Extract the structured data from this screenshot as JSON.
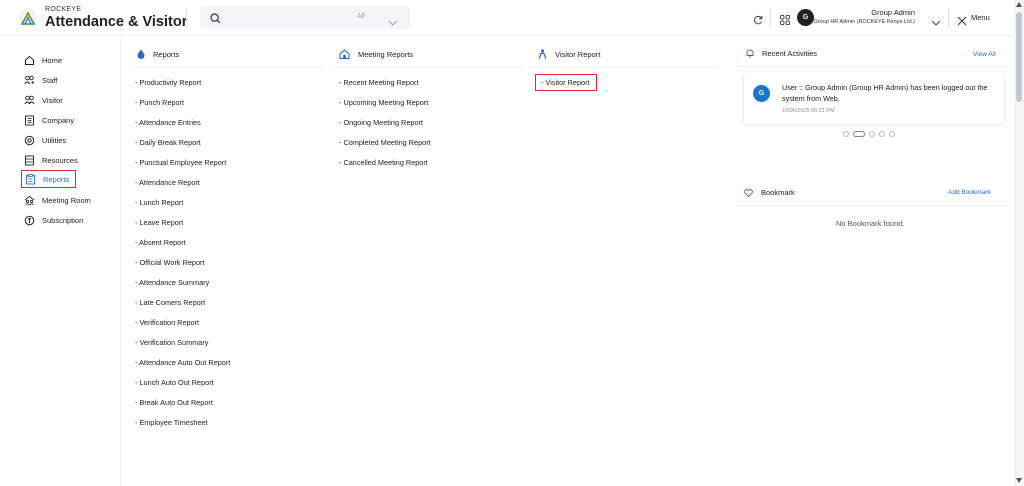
{
  "header": {
    "brand_small": "ROCKEYE",
    "brand_big": "Attendance & Visitor",
    "search_scope": "All",
    "user_name": "Group Admin",
    "user_role": "Group HR Admin (ROCKEYE Kenya Ltd.)",
    "avatar_letter": "G",
    "menu_label": "Menu"
  },
  "sidebar": {
    "items": [
      {
        "label": "Home",
        "icon": "home-icon"
      },
      {
        "label": "Staff",
        "icon": "staff-icon"
      },
      {
        "label": "Visitor",
        "icon": "visitor-icon"
      },
      {
        "label": "Company",
        "icon": "company-icon"
      },
      {
        "label": "Utilities",
        "icon": "utilities-icon"
      },
      {
        "label": "Resources",
        "icon": "resources-icon"
      },
      {
        "label": "Reports",
        "icon": "reports-icon"
      },
      {
        "label": "Meeting Room",
        "icon": "meeting-room-icon"
      },
      {
        "label": "Subscription",
        "icon": "subscription-icon"
      }
    ],
    "active": "Reports"
  },
  "reports": {
    "title": "Reports",
    "items": [
      "- Productivity Report",
      "- Punch Report",
      "- Attendance Entries",
      "- Daily Break Report",
      "- Punctual Employee Report",
      "- Attendance Report",
      "- Lunch Report",
      "- Leave Report",
      "- Absent Report",
      "- Official Work Report",
      "- Attendance Summary",
      "- Late Comers Report",
      "- Verification Report",
      "- Verification Summary",
      "- Attendance Auto Out Report",
      "- Lunch Auto Out Report",
      "- Break Auto Out Report",
      "- Employee Timesheet"
    ]
  },
  "meeting_reports": {
    "title": "Meeting Reports",
    "items": [
      "- Recent Meeting Report",
      "- Upcoming Meeting Report",
      "- Ongoing Meeting Report",
      "- Completed Meeting Report",
      "- Cancelled Meeting Report"
    ]
  },
  "visitor_report": {
    "title": "Visitor Report",
    "items": [
      "- Visitor Report"
    ]
  },
  "recent_activities": {
    "title": "Recent Activities",
    "view_all": "View All",
    "avatar_letter": "G",
    "message": "User :: Group Admin (Group HR Admin) has been logged out the system from Web.",
    "timestamp": "10/06/2025 06:21 PM"
  },
  "bookmark": {
    "title": "Bookmark",
    "add_label": "Add Bookmark",
    "empty_text": "No Bookmark found."
  },
  "colors": {
    "accent": "#2a67d8",
    "highlight": "#e02b2b",
    "avatar_blue": "#1976d2"
  }
}
